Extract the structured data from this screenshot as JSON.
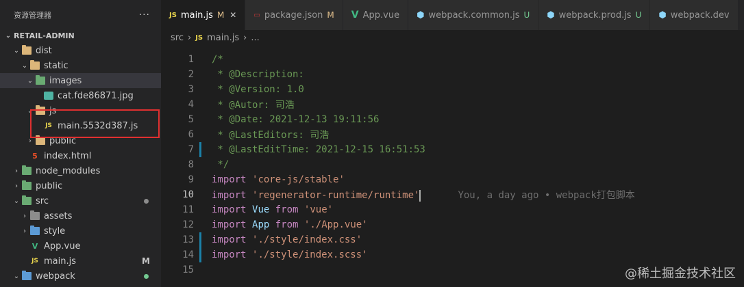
{
  "sidebar": {
    "title": "资源管理器",
    "more": "···",
    "tree": [
      {
        "label": "RETAIL-ADMIN"
      },
      {
        "label": "dist"
      },
      {
        "label": "static"
      },
      {
        "label": "images"
      },
      {
        "label": "cat.fde86871.jpg"
      },
      {
        "label": "js"
      },
      {
        "label": "main.5532d387.js"
      },
      {
        "label": "public"
      },
      {
        "label": "index.html"
      },
      {
        "label": "node_modules"
      },
      {
        "label": "public"
      },
      {
        "label": "src"
      },
      {
        "label": "assets"
      },
      {
        "label": "style"
      },
      {
        "label": "App.vue"
      },
      {
        "label": "main.js",
        "badge": "M"
      },
      {
        "label": "webpack"
      }
    ],
    "icons": {
      "js": "JS",
      "html": "5",
      "vue": "V"
    }
  },
  "tabs": [
    {
      "icon": "JS",
      "label": "main.js",
      "mod": "M",
      "close": "✕"
    },
    {
      "icon": "▭",
      "label": "package.json",
      "mod": "M"
    },
    {
      "icon": "V",
      "label": "App.vue"
    },
    {
      "icon": "⬢",
      "label": "webpack.common.js",
      "mod": "U"
    },
    {
      "icon": "⬢",
      "label": "webpack.prod.js",
      "mod": "U"
    },
    {
      "icon": "⬢",
      "label": "webpack.dev"
    }
  ],
  "breadcrumb": {
    "folder": "src",
    "sep": "›",
    "icon": "JS",
    "file": "main.js",
    "tail": "..."
  },
  "editor": {
    "lines": [
      {
        "num": "1",
        "text": "/*"
      },
      {
        "num": "2",
        "text": " * @Description:"
      },
      {
        "num": "3",
        "text": " * @Version: 1.0"
      },
      {
        "num": "4",
        "text": " * @Autor: 司浩"
      },
      {
        "num": "5",
        "text": " * @Date: 2021-12-13 19:11:56"
      },
      {
        "num": "6",
        "text": " * @LastEditors: 司浩"
      },
      {
        "num": "7",
        "text": " * @LastEditTime: 2021-12-15 16:51:53"
      },
      {
        "num": "8",
        "text": " */"
      },
      {
        "num": "9",
        "kw": "import",
        "str": "'core-js/stable'"
      },
      {
        "num": "10",
        "kw": "import",
        "str": "'regenerator-runtime/runtime'",
        "blame": "You, a day ago • webpack打包脚本"
      },
      {
        "num": "11",
        "kw": "import",
        "id": "Vue",
        "kw2": "from",
        "str": "'vue'"
      },
      {
        "num": "12",
        "kw": "import",
        "id": "App",
        "kw2": "from",
        "str": "'./App.vue'"
      },
      {
        "num": "13",
        "kw": "import",
        "str": "'./style/index.css'"
      },
      {
        "num": "14",
        "kw": "import",
        "str": "'./style/index.scss'"
      },
      {
        "num": "15",
        "text": ""
      }
    ]
  },
  "watermark": "@稀土掘金技术社区"
}
